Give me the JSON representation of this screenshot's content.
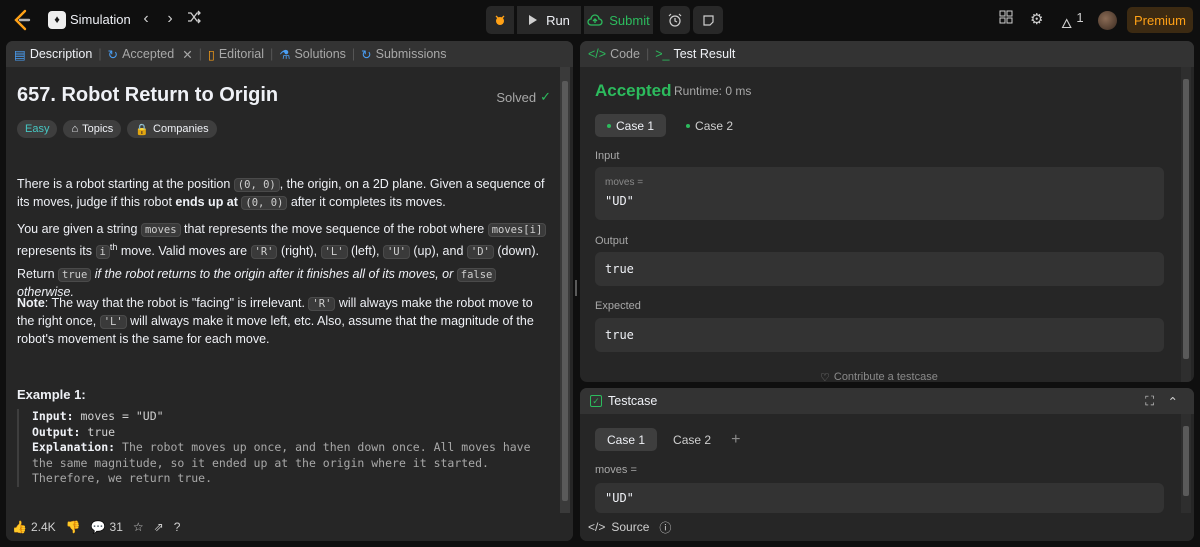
{
  "topbar": {
    "problem_list_label": "Simulation",
    "run_label": "Run",
    "submit_label": "Submit",
    "streak_count": "1",
    "premium_label": "Premium"
  },
  "left_tabs": [
    {
      "label": "Description",
      "icon": "description-icon"
    },
    {
      "label": "Accepted",
      "icon": "accepted-icon"
    },
    {
      "label": "Editorial",
      "icon": "editorial-icon"
    },
    {
      "label": "Solutions",
      "icon": "solutions-icon"
    },
    {
      "label": "Submissions",
      "icon": "submissions-icon"
    }
  ],
  "problem": {
    "title": "657. Robot Return to Origin",
    "solved_label": "Solved",
    "difficulty": "Easy",
    "topics_label": "Topics",
    "companies_label": "Companies",
    "p1_a": "There is a robot starting at the position ",
    "p1_code1": "(0, 0)",
    "p1_b": ", the origin, on a 2D plane. Given a sequence of its moves, judge if this robot ",
    "p1_bold": "ends up at",
    "p1_code2": "(0, 0)",
    "p1_c": " after it completes its moves.",
    "p2_a": "You are given a string ",
    "p2_code1": "moves",
    "p2_b": " that represents the move sequence of the robot where ",
    "p2_code2": "moves[i]",
    "p2_c": " represents its ",
    "p2_ith": "i",
    "p2_th": "th",
    "p2_d": " move. Valid moves are ",
    "p2_R": "'R'",
    "p2_right": " (right), ",
    "p2_L": "'L'",
    "p2_left": " (left), ",
    "p2_U": "'U'",
    "p2_up": " (up), and ",
    "p2_D": "'D'",
    "p2_down": " (down).",
    "p3_a": "Return ",
    "p3_true": "true",
    "p3_b": " if the robot returns to the origin after it finishes all of its moves, or ",
    "p3_false": "false",
    "p3_c": " otherwise.",
    "note_label": "Note",
    "note_a": ": The way that the robot is \"facing\" is irrelevant. ",
    "note_R": "'R'",
    "note_b": " will always make the robot move to the right once, ",
    "note_L": "'L'",
    "note_c": " will always make it move left, etc. Also, assume that the magnitude of the robot's movement is the same for each move.",
    "example_title": "Example 1:",
    "ex_input_label": "Input:",
    "ex_input_value": " moves = \"UD\"",
    "ex_output_label": "Output:",
    "ex_output_value": " true",
    "ex_expl_label": "Explanation:",
    "ex_expl_value": " The robot moves up once, and then down once. All moves have the same magnitude, so it ended up at the origin where it started. Therefore, we return true."
  },
  "left_footer": {
    "likes": "2.4K",
    "comments": "31"
  },
  "right_top": {
    "tab_code": "Code",
    "tab_result": "Test Result",
    "status": "Accepted",
    "runtime": "Runtime: 0 ms",
    "case1": "Case 1",
    "case2": "Case 2",
    "input_label": "Input",
    "input_var": "moves =",
    "input_value": "\"UD\"",
    "output_label": "Output",
    "output_value": "true",
    "expected_label": "Expected",
    "expected_value": "true",
    "contribute": "Contribute a testcase"
  },
  "right_bot": {
    "title": "Testcase",
    "case1": "Case 1",
    "case2": "Case 2",
    "plus": "+",
    "var_label": "moves =",
    "var_value": "\"UD\"",
    "source_label": "Source"
  }
}
